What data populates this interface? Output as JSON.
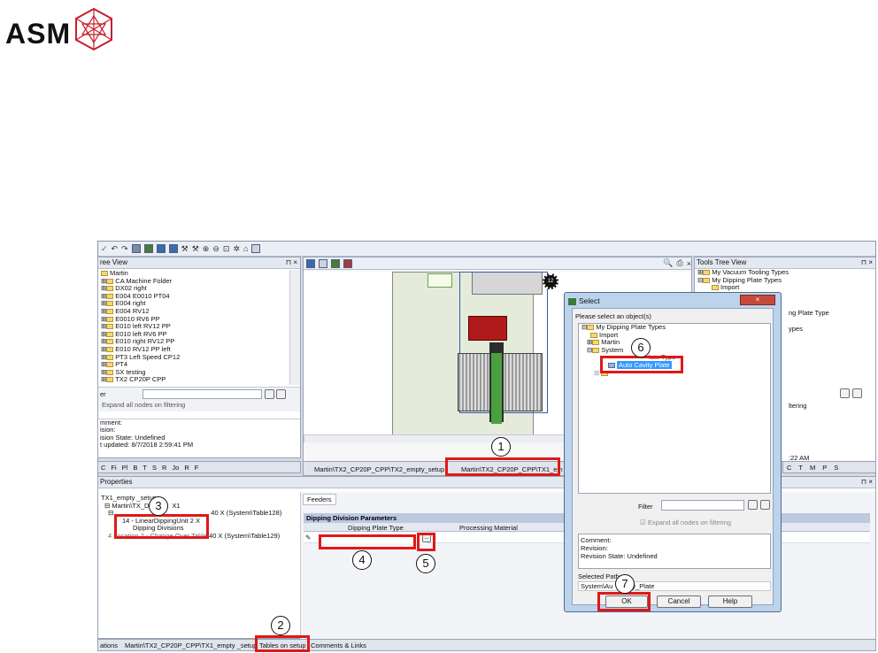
{
  "logo": {
    "text": "ASM",
    "mark": "asm-hexagon-logo"
  },
  "toolbar": {
    "icons": [
      "check-icon",
      "undo-icon",
      "redo-icon",
      "grid-icon",
      "zoom-in-icon",
      "zoom-out-icon",
      "home-icon"
    ]
  },
  "tree_view": {
    "title": "ree View",
    "items": [
      "Martin",
      "CA  Machine  Folder",
      "DX02  right",
      "E004  E0010  PT04",
      "E004  right",
      "E004  RV12",
      "E0010  RV6  PP",
      "E010  left  RV12  PP",
      "E010  left  RV6  PP",
      "E010  right  RV12  PP",
      "E010  RV12  PP  left",
      "PT3  Left  Speed  CP12",
      "PT4",
      "SX  testing",
      "TX2  CP20P  CPP"
    ],
    "filter_label": "er",
    "expand_label": "Expand all nodes on filtering",
    "comment_label": "mment:",
    "revision_label": "ision:",
    "revision_state": "ision State: Undefined",
    "updated": "t updated: 8/7/2018 2:59:41 PM"
  },
  "left_tabs": [
    "C",
    "Fi",
    "Pl",
    "B",
    "T",
    "S",
    "R",
    "Jo",
    "R",
    "F"
  ],
  "tools_tree": {
    "title": "Tools Tree View",
    "items": [
      "My Vacuum Tooling Types",
      "My Dipping Plate Types",
      "Import"
    ],
    "partial_1": "ng Plate Type",
    "partial_2": "ypes",
    "filter_label": "ltering",
    "time": ":22 AM"
  },
  "right_tabs": [
    "C",
    "T",
    "M",
    "P",
    "S"
  ],
  "center": {
    "doc_tab_1": "Martin\\TX2_CP20P_CPP\\TX2_empty_setup",
    "doc_tab_2": "Martin\\TX2_CP20P_CPP\\TX1_em",
    "badge": "12"
  },
  "properties": {
    "title": "Properties",
    "items": [
      "TX1_empty _setup",
      "Martin\\TX_D",
      "40 X (System\\Table128)",
      "14 - LinearDippingUnit 2 X",
      "Dipping Divisions",
      "40 X (System\\Table129)"
    ],
    "partial_1": "X1",
    "partial_2": "4 Location 2 - Change Over Table"
  },
  "feeders": {
    "tab": "Feeders",
    "section_title": "Dipping Division Parameters",
    "col_1": "Dipping Plate Type",
    "col_2": "Processing Material",
    "browse_button": "..."
  },
  "bottom_tabs": {
    "tab_1": "ations",
    "tab_2": "Martin\\TX2_CP20P_CPP\\TX1_empty _setup",
    "tab_3": "Tables on setup",
    "tab_4": "Comments & Links"
  },
  "dialog": {
    "title": "Select",
    "prompt": "Please select an object(s)",
    "tree": [
      "My Dipping Plate Types",
      "Import",
      "Martin",
      "System",
      "late Type",
      "Auto  Cavity  Plate"
    ],
    "filter_label": "Filter",
    "expand_label": "Expand all nodes on filtering",
    "comment_label": "Comment:",
    "revision_label": "Revision:",
    "revision_state": "Revision State: Undefined",
    "selected_path_label": "Selected Path",
    "selected_path_prefix": "System\\Au",
    "selected_path_suffix": "ty_Plate",
    "ok": "OK",
    "cancel": "Cancel",
    "help": "Help"
  },
  "callouts": [
    "1",
    "2",
    "3",
    "4",
    "5",
    "6",
    "7"
  ],
  "colors": {
    "highlight_red": "#e01818",
    "selection_blue": "#3399ff",
    "frame": "#d6dbe6"
  }
}
